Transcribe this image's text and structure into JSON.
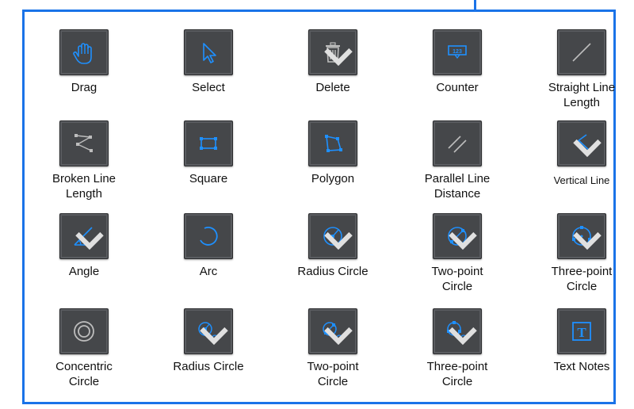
{
  "colors": {
    "accent": "#1a73e8",
    "icon_blue": "#1e90ff",
    "icon_gray": "#bdbdbd",
    "button_bg": "#45474a"
  },
  "tools": [
    {
      "label": "Drag",
      "icon": "hand-icon",
      "dropdown": false
    },
    {
      "label": "Select",
      "icon": "cursor-icon",
      "dropdown": false
    },
    {
      "label": "Delete",
      "icon": "trash-icon",
      "dropdown": true
    },
    {
      "label": "Counter",
      "icon": "counter-icon",
      "dropdown": false
    },
    {
      "label": "Straight Line\nLength",
      "icon": "straight-line-icon",
      "dropdown": false
    },
    {
      "label": "Broken Line\nLength",
      "icon": "broken-line-icon",
      "dropdown": false
    },
    {
      "label": "Square",
      "icon": "square-icon",
      "dropdown": false
    },
    {
      "label": "Polygon",
      "icon": "polygon-icon",
      "dropdown": false
    },
    {
      "label": "Parallel Line\nDistance",
      "icon": "parallel-lines-icon",
      "dropdown": false
    },
    {
      "label": "Vertical Line",
      "icon": "vertical-line-icon",
      "dropdown": true
    },
    {
      "label": "Angle",
      "icon": "angle-icon",
      "dropdown": true
    },
    {
      "label": "Arc",
      "icon": "arc-icon",
      "dropdown": false
    },
    {
      "label": "Radius Circle",
      "icon": "radius-circle-icon",
      "dropdown": true
    },
    {
      "label": "Two-point\nCircle",
      "icon": "two-point-circle-icon",
      "dropdown": true
    },
    {
      "label": "Three-point\nCircle",
      "icon": "three-point-circle-icon",
      "dropdown": true
    },
    {
      "label": "Concentric\nCircle",
      "icon": "concentric-circle-icon",
      "dropdown": false
    },
    {
      "label": "Radius Circle",
      "icon": "radius-circle-distance-icon",
      "dropdown": true
    },
    {
      "label": "Two-point\nCircle",
      "icon": "two-point-circle-distance-icon",
      "dropdown": true
    },
    {
      "label": "Three-point\nCircle",
      "icon": "three-point-circle-distance-icon",
      "dropdown": true
    },
    {
      "label": "Text Notes",
      "icon": "text-notes-icon",
      "dropdown": false
    }
  ]
}
